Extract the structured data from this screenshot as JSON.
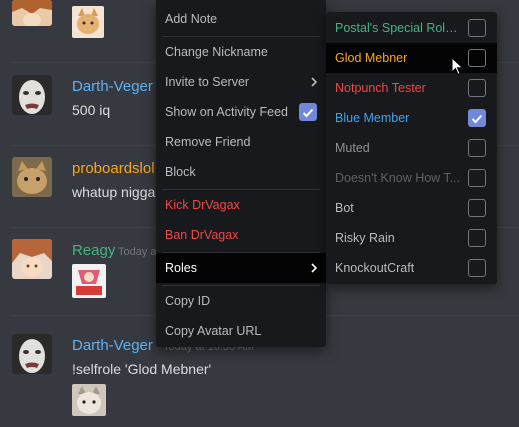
{
  "chat": {
    "messages": [
      {
        "username": "Darth-Veger",
        "username_color": "#5fb2f5",
        "text": "500 iq"
      },
      {
        "username": "proboardslol",
        "username_color": "#faa61a",
        "text": "whatup nigga"
      },
      {
        "username": "Reagy",
        "username_color": "#43b581",
        "timestamp": "Today a"
      },
      {
        "username": "Darth-Veger",
        "username_color": "#5fb2f5",
        "timestamp": "Today at 10:33 AM",
        "text": "!selfrole 'Glod Mebner'"
      }
    ]
  },
  "context_menu": {
    "items": [
      {
        "label": "Add Note"
      },
      {
        "label": "Change Nickname"
      },
      {
        "label": "Invite to Server",
        "submenu_icon": "chevron-right-icon"
      },
      {
        "label": "Show on Activity Feed",
        "checked": true
      },
      {
        "label": "Remove Friend"
      },
      {
        "label": "Block"
      },
      {
        "label": "Kick DrVagax",
        "danger": true
      },
      {
        "label": "Ban DrVagax",
        "danger": true
      },
      {
        "label": "Roles",
        "submenu_icon": "chevron-right-icon",
        "highlighted": true
      },
      {
        "label": "Copy ID"
      },
      {
        "label": "Copy Avatar URL"
      }
    ]
  },
  "roles_submenu": {
    "roles": [
      {
        "name": "Postal's Special Role ...",
        "color": "#43b581",
        "checked": false
      },
      {
        "name": "Glod Mebner",
        "color": "#faa61a",
        "checked": false,
        "hovered": true
      },
      {
        "name": "Notpunch Tester",
        "color": "#f04747",
        "checked": false
      },
      {
        "name": "Blue Member",
        "color": "#3ca4f0",
        "checked": true
      },
      {
        "name": "Muted",
        "color": "#8e9297",
        "checked": false
      },
      {
        "name": "Doesn't Know How T...",
        "color": "#5d6166",
        "checked": false
      },
      {
        "name": "Bot",
        "color": "#b9bbbe",
        "checked": false
      },
      {
        "name": "Risky Rain",
        "color": "#b9bbbe",
        "checked": false
      },
      {
        "name": "KnockoutCraft",
        "color": "#b9bbbe",
        "checked": false
      }
    ]
  },
  "colors": {
    "background": "#36393f",
    "menu_bg": "#18191c",
    "accent": "#7289da",
    "danger": "#f04747"
  }
}
